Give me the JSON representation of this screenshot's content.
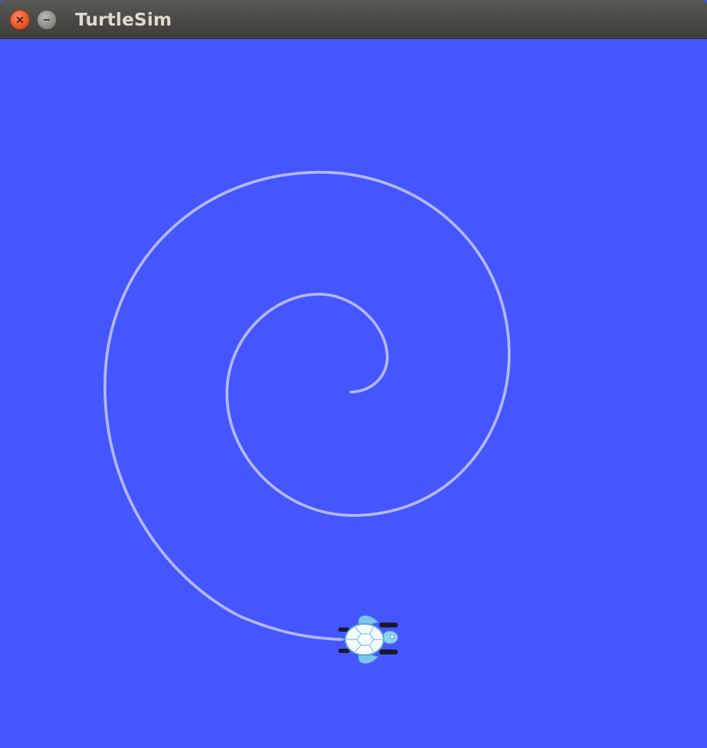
{
  "window": {
    "title": "TurtleSim",
    "close_icon": "close-icon",
    "minimize_icon": "minimize-icon"
  },
  "canvas": {
    "background_color": "#4556ff",
    "pen_color": "#b3b8ff"
  },
  "turtle": {
    "icon": "turtle-icon"
  }
}
